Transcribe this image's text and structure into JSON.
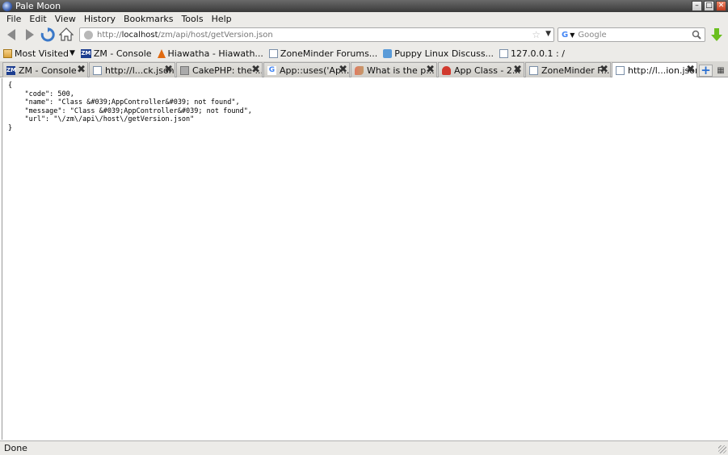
{
  "window": {
    "title": "Pale Moon"
  },
  "menubar": {
    "items": [
      "File",
      "Edit",
      "View",
      "History",
      "Bookmarks",
      "Tools",
      "Help"
    ]
  },
  "navbar": {
    "url_prefix": "http://",
    "url_host": "localhost",
    "url_path": "/zm/api/host/getVersion.json",
    "search_engine": "G",
    "search_placeholder": "Google"
  },
  "bookmarks": {
    "items": [
      {
        "label": "Most Visited",
        "icon": "folder-icon"
      },
      {
        "label": "ZM - Console",
        "icon": "zm-icon"
      },
      {
        "label": "Hiawatha - Hiawath...",
        "icon": "flame-icon"
      },
      {
        "label": "ZoneMinder Forums...",
        "icon": "page-icon"
      },
      {
        "label": "Puppy Linux Discuss...",
        "icon": "puppy-icon"
      },
      {
        "label": "127.0.0.1 : /",
        "icon": "page-icon"
      }
    ]
  },
  "tabs": [
    {
      "label": "ZM - Console",
      "icon": "zm-icon",
      "active": false
    },
    {
      "label": "http://l...ck.json",
      "icon": "page-icon",
      "active": false
    },
    {
      "label": "CakePHP: the ...",
      "icon": "cake-icon",
      "active": false
    },
    {
      "label": "App::uses('Ap...",
      "icon": "google-icon",
      "active": false
    },
    {
      "label": "What is the p...",
      "icon": "feather-icon",
      "active": false
    },
    {
      "label": "App Class - 2.x",
      "icon": "hat-icon",
      "active": false
    },
    {
      "label": "ZoneMinder F...",
      "icon": "page-icon",
      "active": false
    },
    {
      "label": "http://l...ion.json",
      "icon": "page-icon",
      "active": true
    }
  ],
  "content": {
    "json_text": "{\n    \"code\": 500,\n    \"name\": \"Class &#039;AppController&#039; not found\",\n    \"message\": \"Class &#039;AppController&#039; not found\",\n    \"url\": \"\\/zm\\/api\\/host\\/getVersion.json\"\n}"
  },
  "status": {
    "text": "Done"
  },
  "colors": {
    "chrome": "#ecebe8",
    "accent_blue": "#2a6fd0",
    "download_green": "#6bbf1f"
  }
}
